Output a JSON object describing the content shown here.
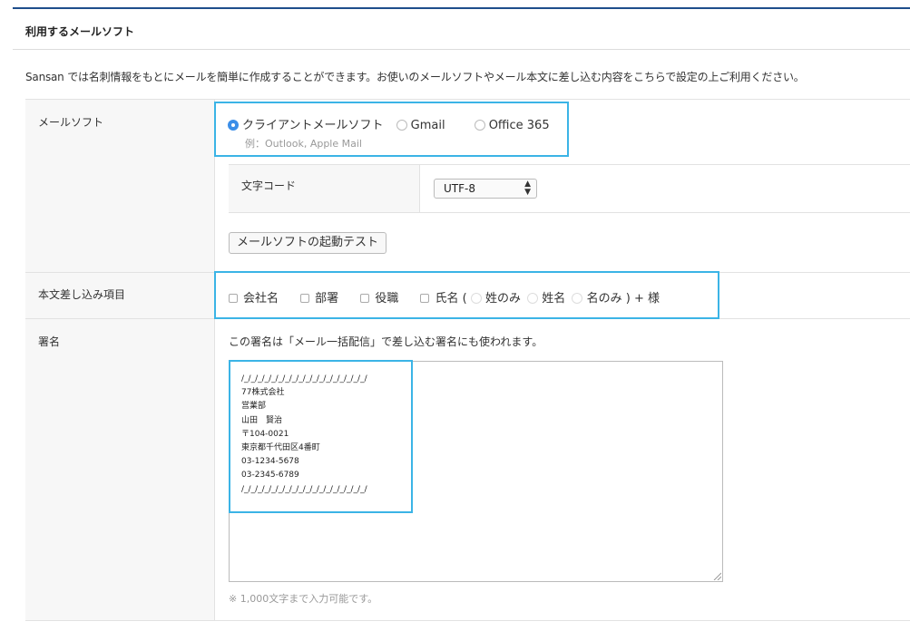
{
  "section": {
    "title": "利用するメールソフト"
  },
  "description": "Sansan では名刺情報をもとにメールを簡単に作成することができます。お使いのメールソフトやメール本文に差し込む内容をこちらで設定の上ご利用ください。",
  "mail_software": {
    "label": "メールソフト",
    "options": [
      {
        "label": "クライアントメールソフト",
        "selected": true
      },
      {
        "label": "Gmail",
        "selected": false
      },
      {
        "label": "Office 365",
        "selected": false
      }
    ],
    "example": "例：Outlook, Apple Mail",
    "charset": {
      "label": "文字コード",
      "value": "UTF-8"
    },
    "test_button": "メールソフトの起動テスト"
  },
  "merge_fields": {
    "label": "本文差し込み項目",
    "company": "会社名",
    "department": "部署",
    "title": "役職",
    "name": "氏名",
    "paren_open": "(",
    "name_options": [
      "姓のみ",
      "姓名",
      "名のみ"
    ],
    "suffix": ") + 様"
  },
  "signature": {
    "label": "署名",
    "note": "この署名は「メール一括配信」で差し込む署名にも使われます。",
    "lines": [
      "/_/_/_/_/_/_/_/_/_/_/_/_/_/_/_/_/_/_/",
      "77株式会社",
      "営業部",
      "山田　賢治",
      "〒104-0021",
      "東京都千代田区4番町",
      "03-1234-5678",
      "03-2345-6789",
      "/_/_/_/_/_/_/_/_/_/_/_/_/_/_/_/_/_/_/"
    ],
    "limit_note": "※ 1,000文字まで入力可能です。"
  },
  "colors": {
    "accent": "#3b8ee8",
    "highlight": "#3bb4e6",
    "top_rule": "#1f4e8c"
  }
}
